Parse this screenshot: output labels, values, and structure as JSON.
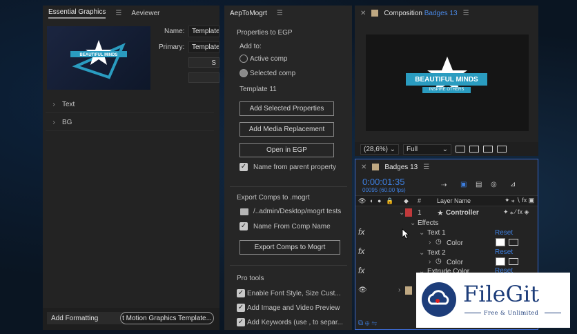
{
  "eg": {
    "tab_active": "Essential Graphics",
    "tab_other": "Aeviewer",
    "name_label": "Name:",
    "name_value": "Template",
    "primary_label": "Primary:",
    "primary_value": "Template",
    "btn_partial": "S",
    "layers": [
      {
        "label": "Text"
      },
      {
        "label": "BG"
      }
    ],
    "add_formatting": "Add Formatting",
    "export_partial": "t Motion Graphics Template..."
  },
  "aep": {
    "title": "AepToMogrt",
    "properties_title": "Properties to EGP",
    "add_to": "Add to:",
    "radio_active": "Active comp",
    "radio_selected": "Selected comp",
    "template_name": "Template 11",
    "btn_add_props": "Add Selected Properties",
    "btn_add_media": "Add Media Replacement",
    "btn_open_egp": "Open in EGP",
    "check_name_parent": "Name from parent property",
    "export_title": "Export Comps to .mogrt",
    "export_path": "/..admin/Desktop/mogrt tests",
    "check_name_comp": "Name From Comp Name",
    "btn_export": "Export Comps to Mogrt",
    "pro_title": "Pro tools",
    "check_font": "Enable Font Style, Size Cust...",
    "check_preview": "Add Image and Video Preview",
    "check_keywords": "Add Keywords (use , to separ..."
  },
  "comp": {
    "tab_prefix": "Composition",
    "tab_name": "Badges 13",
    "badge_main": "BEAUTIFUL MINDS",
    "badge_sub": "INSPIRE OTHERS",
    "zoom": "(28,6%)",
    "resolution": "Full"
  },
  "timeline": {
    "tab": "Badges 13",
    "timecode": "0:00:01:35",
    "frame_info": "00095 (60.00 fps)",
    "col_hash": "#",
    "col_layer": "Layer Name",
    "layer_num": "1",
    "layer_name": "Controller",
    "effects": "Effects",
    "text1": "Text 1",
    "text2": "Text 2",
    "color": "Color",
    "reset": "Reset",
    "extrude": "Extrude Color",
    "fx": "fx"
  },
  "logo": {
    "title": "FileGit",
    "subtitle": "Free & Unlimited"
  },
  "colors": {
    "accent_blue": "#3d7fe0",
    "badge_teal": "#2a9cc0",
    "layer_red": "#c0393b",
    "logo_navy": "#1d3d7a"
  }
}
